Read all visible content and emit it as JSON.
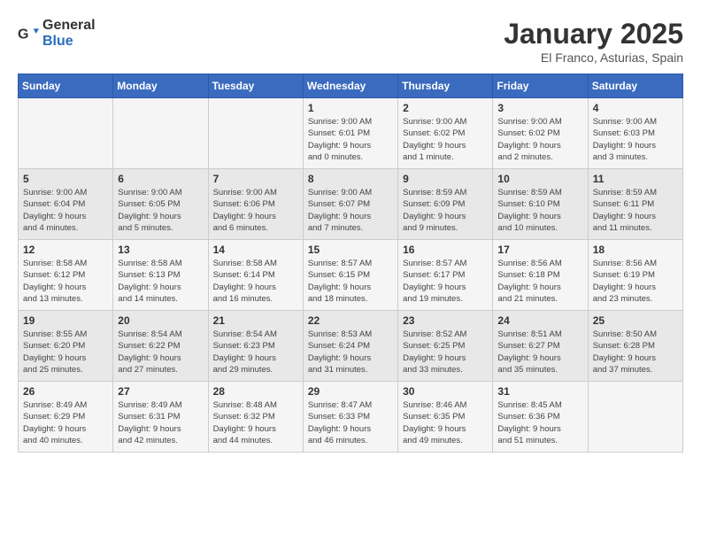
{
  "header": {
    "logo_general": "General",
    "logo_blue": "Blue",
    "month_title": "January 2025",
    "location": "El Franco, Asturias, Spain"
  },
  "calendar": {
    "days_of_week": [
      "Sunday",
      "Monday",
      "Tuesday",
      "Wednesday",
      "Thursday",
      "Friday",
      "Saturday"
    ],
    "weeks": [
      [
        {
          "day": "",
          "info": ""
        },
        {
          "day": "",
          "info": ""
        },
        {
          "day": "",
          "info": ""
        },
        {
          "day": "1",
          "info": "Sunrise: 9:00 AM\nSunset: 6:01 PM\nDaylight: 9 hours\nand 0 minutes."
        },
        {
          "day": "2",
          "info": "Sunrise: 9:00 AM\nSunset: 6:02 PM\nDaylight: 9 hours\nand 1 minute."
        },
        {
          "day": "3",
          "info": "Sunrise: 9:00 AM\nSunset: 6:02 PM\nDaylight: 9 hours\nand 2 minutes."
        },
        {
          "day": "4",
          "info": "Sunrise: 9:00 AM\nSunset: 6:03 PM\nDaylight: 9 hours\nand 3 minutes."
        }
      ],
      [
        {
          "day": "5",
          "info": "Sunrise: 9:00 AM\nSunset: 6:04 PM\nDaylight: 9 hours\nand 4 minutes."
        },
        {
          "day": "6",
          "info": "Sunrise: 9:00 AM\nSunset: 6:05 PM\nDaylight: 9 hours\nand 5 minutes."
        },
        {
          "day": "7",
          "info": "Sunrise: 9:00 AM\nSunset: 6:06 PM\nDaylight: 9 hours\nand 6 minutes."
        },
        {
          "day": "8",
          "info": "Sunrise: 9:00 AM\nSunset: 6:07 PM\nDaylight: 9 hours\nand 7 minutes."
        },
        {
          "day": "9",
          "info": "Sunrise: 8:59 AM\nSunset: 6:09 PM\nDaylight: 9 hours\nand 9 minutes."
        },
        {
          "day": "10",
          "info": "Sunrise: 8:59 AM\nSunset: 6:10 PM\nDaylight: 9 hours\nand 10 minutes."
        },
        {
          "day": "11",
          "info": "Sunrise: 8:59 AM\nSunset: 6:11 PM\nDaylight: 9 hours\nand 11 minutes."
        }
      ],
      [
        {
          "day": "12",
          "info": "Sunrise: 8:58 AM\nSunset: 6:12 PM\nDaylight: 9 hours\nand 13 minutes."
        },
        {
          "day": "13",
          "info": "Sunrise: 8:58 AM\nSunset: 6:13 PM\nDaylight: 9 hours\nand 14 minutes."
        },
        {
          "day": "14",
          "info": "Sunrise: 8:58 AM\nSunset: 6:14 PM\nDaylight: 9 hours\nand 16 minutes."
        },
        {
          "day": "15",
          "info": "Sunrise: 8:57 AM\nSunset: 6:15 PM\nDaylight: 9 hours\nand 18 minutes."
        },
        {
          "day": "16",
          "info": "Sunrise: 8:57 AM\nSunset: 6:17 PM\nDaylight: 9 hours\nand 19 minutes."
        },
        {
          "day": "17",
          "info": "Sunrise: 8:56 AM\nSunset: 6:18 PM\nDaylight: 9 hours\nand 21 minutes."
        },
        {
          "day": "18",
          "info": "Sunrise: 8:56 AM\nSunset: 6:19 PM\nDaylight: 9 hours\nand 23 minutes."
        }
      ],
      [
        {
          "day": "19",
          "info": "Sunrise: 8:55 AM\nSunset: 6:20 PM\nDaylight: 9 hours\nand 25 minutes."
        },
        {
          "day": "20",
          "info": "Sunrise: 8:54 AM\nSunset: 6:22 PM\nDaylight: 9 hours\nand 27 minutes."
        },
        {
          "day": "21",
          "info": "Sunrise: 8:54 AM\nSunset: 6:23 PM\nDaylight: 9 hours\nand 29 minutes."
        },
        {
          "day": "22",
          "info": "Sunrise: 8:53 AM\nSunset: 6:24 PM\nDaylight: 9 hours\nand 31 minutes."
        },
        {
          "day": "23",
          "info": "Sunrise: 8:52 AM\nSunset: 6:25 PM\nDaylight: 9 hours\nand 33 minutes."
        },
        {
          "day": "24",
          "info": "Sunrise: 8:51 AM\nSunset: 6:27 PM\nDaylight: 9 hours\nand 35 minutes."
        },
        {
          "day": "25",
          "info": "Sunrise: 8:50 AM\nSunset: 6:28 PM\nDaylight: 9 hours\nand 37 minutes."
        }
      ],
      [
        {
          "day": "26",
          "info": "Sunrise: 8:49 AM\nSunset: 6:29 PM\nDaylight: 9 hours\nand 40 minutes."
        },
        {
          "day": "27",
          "info": "Sunrise: 8:49 AM\nSunset: 6:31 PM\nDaylight: 9 hours\nand 42 minutes."
        },
        {
          "day": "28",
          "info": "Sunrise: 8:48 AM\nSunset: 6:32 PM\nDaylight: 9 hours\nand 44 minutes."
        },
        {
          "day": "29",
          "info": "Sunrise: 8:47 AM\nSunset: 6:33 PM\nDaylight: 9 hours\nand 46 minutes."
        },
        {
          "day": "30",
          "info": "Sunrise: 8:46 AM\nSunset: 6:35 PM\nDaylight: 9 hours\nand 49 minutes."
        },
        {
          "day": "31",
          "info": "Sunrise: 8:45 AM\nSunset: 6:36 PM\nDaylight: 9 hours\nand 51 minutes."
        },
        {
          "day": "",
          "info": ""
        }
      ]
    ]
  }
}
